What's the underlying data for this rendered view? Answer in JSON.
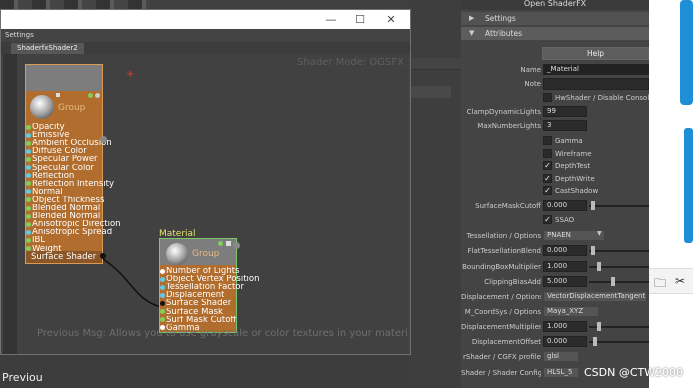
{
  "taskbar": {
    "bottom_label": "Previou"
  },
  "window": {
    "menu_label": "Settings",
    "tab_label": "ShaderfxShader2",
    "controls": {
      "minimize": "—",
      "maximize": "☐",
      "close": "✕"
    },
    "shader_mode": "Shader Mode: OGSFX",
    "previous_msg": "Previous Msg: Allows you to use grayscale or color textures in your material",
    "group_node": {
      "label": "Group",
      "inputs": [
        {
          "label": "Opacity",
          "pin": "#7ed05a"
        },
        {
          "label": "Emissive",
          "pin": "#5fc9e8"
        },
        {
          "label": "Ambient Occlusion",
          "pin": "#7ed05a"
        },
        {
          "label": "Diffuse Color",
          "pin": "#5fc9e8"
        },
        {
          "label": "Specular Power",
          "pin": "#7ed05a"
        },
        {
          "label": "Specular Color",
          "pin": "#5fc9e8"
        },
        {
          "label": "Reflection",
          "pin": "#5fc9e8"
        },
        {
          "label": "Reflection Intensity",
          "pin": "#7ed05a"
        },
        {
          "label": "Normal",
          "pin": "#5fc9e8"
        },
        {
          "label": "Object Thickness",
          "pin": "#7ed05a"
        },
        {
          "label": "Blended Normal",
          "pin": "#7ed05a"
        },
        {
          "label": "Blended Normal",
          "pin": "#7ed05a"
        },
        {
          "label": "Anisotropic Direction",
          "pin": "#7ed05a"
        },
        {
          "label": "Anisotropic Spread",
          "pin": "#5fc9e8"
        },
        {
          "label": "IBL",
          "pin": "#7ed05a"
        },
        {
          "label": "Weight",
          "pin": "#7ed05a"
        }
      ],
      "output": "Surface Shader"
    },
    "material_node": {
      "title": "Material",
      "label": "Group",
      "inputs": [
        {
          "label": "Number of Lights",
          "pin": "#ffffff"
        },
        {
          "label": "Object Vertex Position",
          "pin": "#5fc9e8"
        },
        {
          "label": "Tessellation Factor",
          "pin": "#5fc9e8"
        },
        {
          "label": "Displacement",
          "pin": "#5fc9e8"
        },
        {
          "label": "Surface Shader",
          "pin": "#111111"
        },
        {
          "label": "Surface Mask",
          "pin": "#7ed05a"
        },
        {
          "label": "Surf Mask Cutoff",
          "pin": "#7ed05a"
        },
        {
          "label": "Gamma",
          "pin": "#ffffff"
        }
      ]
    }
  },
  "attribute_editor": {
    "header": "Open ShaderFX",
    "sections": {
      "settings": "Settings",
      "attributes": "Attributes"
    },
    "help": "Help",
    "name_label": "Name",
    "name_value": "_Material",
    "note_label": "Note",
    "hwshader_label": "HwShader / Disable Console",
    "clamp_label": "ClampDynamicLights",
    "clamp_value": "99",
    "maxlights_label": "MaxNumberLights",
    "maxlights_value": "3",
    "checkboxes": [
      {
        "label": "Gamma",
        "checked": false
      },
      {
        "label": "Wireframe",
        "checked": false
      },
      {
        "label": "DepthTest",
        "checked": true
      },
      {
        "label": "DepthWrite",
        "checked": true
      },
      {
        "label": "CastShadow",
        "checked": true
      }
    ],
    "surface_mask_label": "SurfaceMaskCutoff",
    "surface_mask_value": "0.000",
    "ssao_label": "SSAO",
    "tess_label": "Tessellation / Options",
    "tess_value": "PNAEN",
    "flat_label": "FlatTessellationBlend",
    "flat_value": "0.000",
    "bbox_label": "BoundingBoxMultiplier",
    "bbox_value": "1.000",
    "clip_label": "ClippingBiasAdd",
    "clip_value": "5.000",
    "disp_label": "Displacement / Options",
    "disp_value": "VectorDisplacementTangent",
    "coord_label": "M_CoordSys / Options",
    "coord_value": "Maya_XYZ",
    "dispmult_label": "DisplacementMultiplier",
    "dispmult_value": "1.000",
    "dispoff_label": "DisplacementOffset",
    "dispoff_value": "0.000",
    "cgfx_label": "rShader / CGFX profile",
    "cgfx_value": "glsl",
    "shadercfg_label": "Shader / Shader Config",
    "shadercfg_value": "HLSL_5"
  },
  "side_panel": {
    "folder_icon": "folder-icon",
    "scissors_icon": "scissors-icon"
  },
  "watermark": "CSDN @CTW2000",
  "colors": {
    "node_body": "#b06d2e",
    "node_header": "#7d7d7d",
    "wire": "#111111"
  }
}
